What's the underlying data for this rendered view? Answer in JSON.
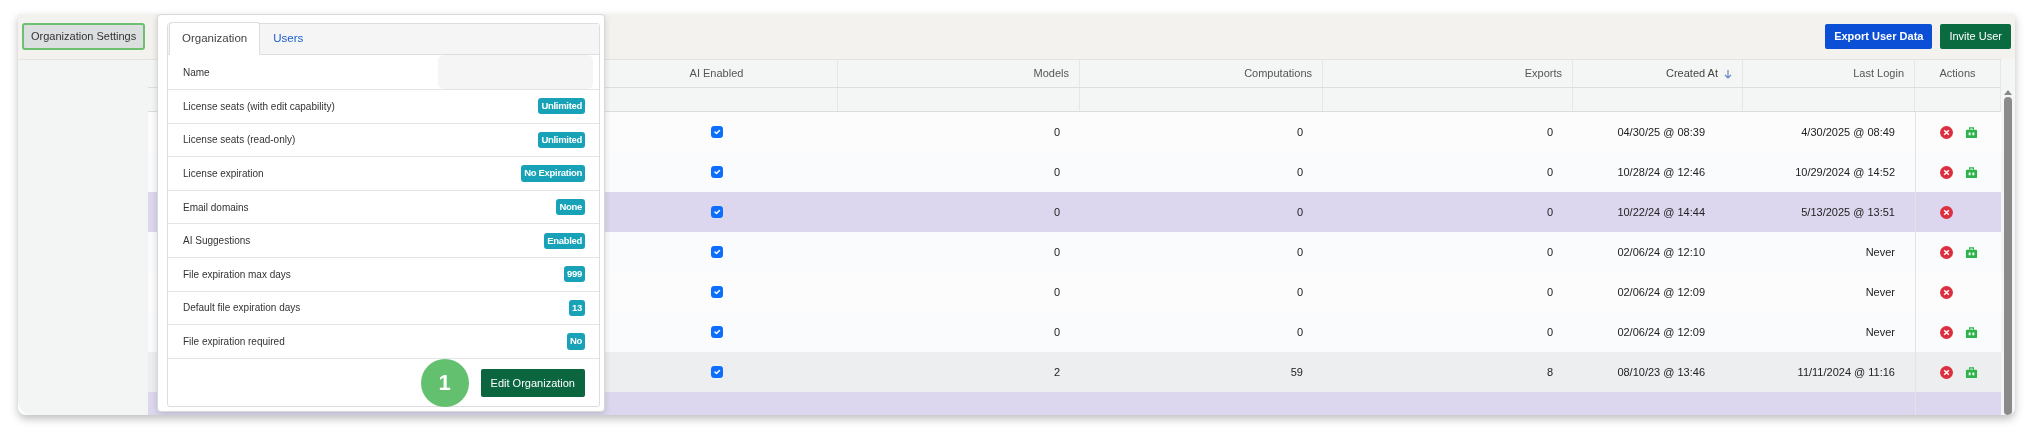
{
  "toolbar": {
    "settings_button": "Organization Settings",
    "buttons": [
      {
        "label": "Export User Data",
        "kind": "primary"
      },
      {
        "label": "Invite User",
        "kind": "success"
      }
    ]
  },
  "table": {
    "columns": [
      {
        "label": "AI Enabled",
        "sorted": false
      },
      {
        "label": "Models",
        "sorted": false
      },
      {
        "label": "Computations",
        "sorted": false
      },
      {
        "label": "Exports",
        "sorted": false
      },
      {
        "label": "Created At",
        "sorted": true
      },
      {
        "label": "Last Login",
        "sorted": false
      },
      {
        "label": "Actions",
        "sorted": false
      }
    ],
    "rows": [
      {
        "ai_enabled": true,
        "models": "0",
        "computations": "0",
        "exports": "0",
        "created_at": "04/30/25 @ 08:39",
        "last_login": "4/30/2025 @ 08:49",
        "selected": false,
        "hovered": false,
        "license": true
      },
      {
        "ai_enabled": true,
        "models": "0",
        "computations": "0",
        "exports": "0",
        "created_at": "10/28/24 @ 12:46",
        "last_login": "10/29/2024 @ 14:52",
        "selected": false,
        "hovered": false,
        "license": true
      },
      {
        "ai_enabled": true,
        "models": "0",
        "computations": "0",
        "exports": "0",
        "created_at": "10/22/24 @ 14:44",
        "last_login": "5/13/2025 @ 13:51",
        "selected": true,
        "hovered": false,
        "license": false
      },
      {
        "ai_enabled": true,
        "models": "0",
        "computations": "0",
        "exports": "0",
        "created_at": "02/06/24 @ 12:10",
        "last_login": "Never",
        "selected": false,
        "hovered": false,
        "license": true
      },
      {
        "ai_enabled": true,
        "models": "0",
        "computations": "0",
        "exports": "0",
        "created_at": "02/06/24 @ 12:09",
        "last_login": "Never",
        "selected": false,
        "hovered": false,
        "license": false
      },
      {
        "ai_enabled": true,
        "models": "0",
        "computations": "0",
        "exports": "0",
        "created_at": "02/06/24 @ 12:09",
        "last_login": "Never",
        "selected": false,
        "hovered": false,
        "license": true
      },
      {
        "ai_enabled": true,
        "models": "2",
        "computations": "59",
        "exports": "8",
        "created_at": "08/10/23 @ 13:46",
        "last_login": "11/11/2024 @ 11:16",
        "selected": false,
        "hovered": true,
        "license": true
      },
      {
        "selected": true,
        "hovered": false
      }
    ]
  },
  "popover": {
    "tabs": [
      {
        "label": "Organization",
        "selected": true
      },
      {
        "label": "Users",
        "selected": false
      }
    ],
    "settings": [
      {
        "label": "Name",
        "kind": "redacted"
      },
      {
        "label": "License seats (with edit capability)",
        "kind": "badge",
        "value": "Unlimited"
      },
      {
        "label": "License seats (read-only)",
        "kind": "badge",
        "value": "Unlimited"
      },
      {
        "label": "License expiration",
        "kind": "badge",
        "value": "No Expiration"
      },
      {
        "label": "Email domains",
        "kind": "badge",
        "value": "None"
      },
      {
        "label": "AI Suggestions",
        "kind": "badge",
        "value": "Enabled"
      },
      {
        "label": "File expiration max days",
        "kind": "badge",
        "value": "999"
      },
      {
        "label": "Default file expiration days",
        "kind": "badge",
        "value": "13"
      },
      {
        "label": "File expiration required",
        "kind": "badge",
        "value": "No"
      }
    ],
    "step_marker": "1",
    "edit_button": "Edit Organization"
  }
}
